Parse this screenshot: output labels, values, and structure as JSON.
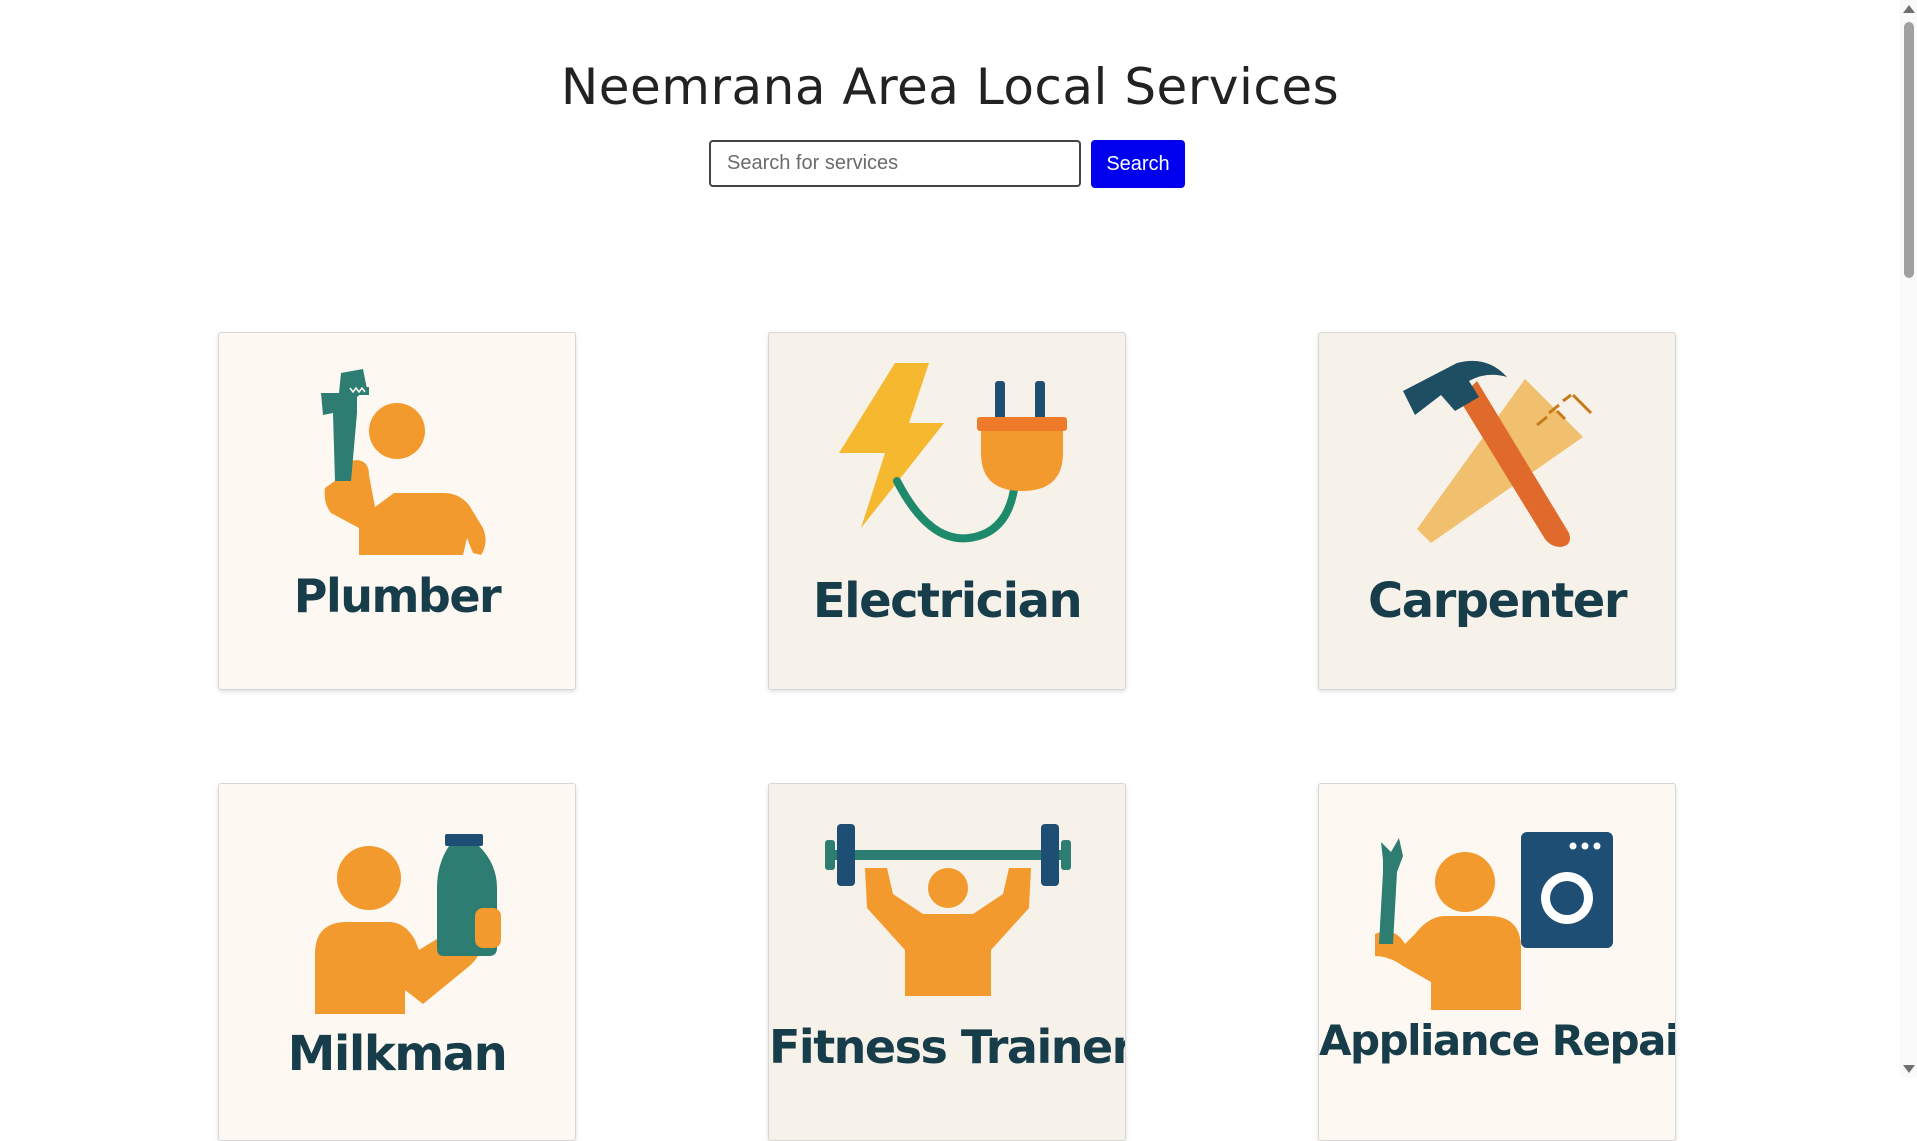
{
  "header": {
    "title": "Neemrana Area Local Services"
  },
  "search": {
    "placeholder": "Search for services",
    "button_label": "Search"
  },
  "services": [
    {
      "label": "Plumber",
      "icon": "plumber-icon"
    },
    {
      "label": "Electrician",
      "icon": "electrician-icon"
    },
    {
      "label": "Carpenter",
      "icon": "carpenter-icon"
    },
    {
      "label": "Milkman",
      "icon": "milkman-icon"
    },
    {
      "label": "Fitness Trainer",
      "icon": "fitness-trainer-icon"
    },
    {
      "label": "Appliance Repair",
      "icon": "appliance-repair-icon"
    }
  ],
  "colors": {
    "accent_button": "#0000ee",
    "label_text": "#173c4a",
    "orange": "#f39a2e",
    "teal": "#2e7d72"
  }
}
